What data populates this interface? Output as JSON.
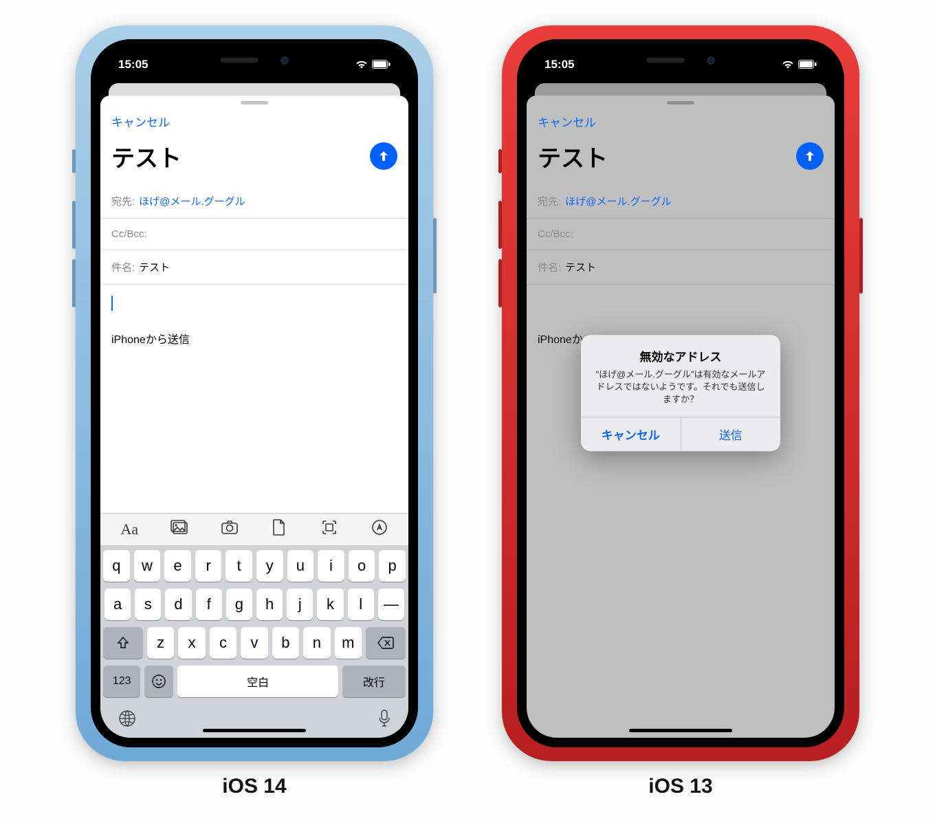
{
  "left": {
    "caption": "iOS 14",
    "time": "15:05",
    "cancel": "キャンセル",
    "title": "テスト",
    "to_label": "宛先:",
    "to_value": "ほげ@メール.グーグル",
    "ccbcc_label": "Cc/Bcc:",
    "subject_label": "件名:",
    "subject_value": "テスト",
    "signature": "iPhoneから送信",
    "toolbar": {
      "aa": "Aa"
    },
    "keys_r1": [
      "q",
      "w",
      "e",
      "r",
      "t",
      "y",
      "u",
      "i",
      "o",
      "p"
    ],
    "keys_r2": [
      "a",
      "s",
      "d",
      "f",
      "g",
      "h",
      "j",
      "k",
      "l",
      "—"
    ],
    "keys_r3": [
      "z",
      "x",
      "c",
      "v",
      "b",
      "n",
      "m"
    ],
    "key_123": "123",
    "key_space": "空白",
    "key_return": "改行"
  },
  "right": {
    "caption": "iOS 13",
    "time": "15:05",
    "cancel": "キャンセル",
    "title": "テスト",
    "to_label": "宛先:",
    "to_value": "ほげ@メール.グーグル",
    "ccbcc_label": "Cc/Bcc:",
    "subject_label": "件名:",
    "subject_value": "テスト",
    "signature_trunc": "iPhoneか",
    "alert": {
      "title": "無効なアドレス",
      "message": "\"ほげ@メール.グーグル\"は有効なメールアドレスではないようです。それでも送信しますか？",
      "cancel": "キャンセル",
      "send": "送信"
    }
  }
}
